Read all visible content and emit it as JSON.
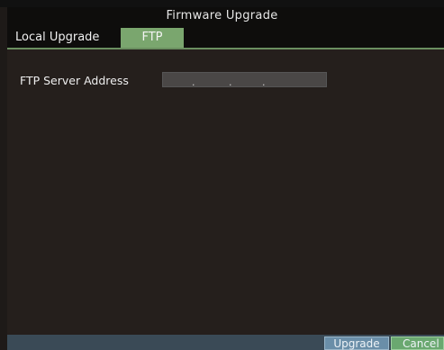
{
  "window": {
    "title": "Firmware Upgrade"
  },
  "tabs": [
    {
      "label": "Local Upgrade",
      "active": false
    },
    {
      "label": "FTP",
      "active": true
    }
  ],
  "ftp": {
    "server_address_label": "FTP Server Address",
    "server_address_value": ". . ."
  },
  "buttons": {
    "upgrade": "Upgrade",
    "cancel": "Cancel"
  },
  "colors": {
    "active_tab": "#7aa66e",
    "upgrade_button": "#6a8ea8",
    "cancel_button": "#6aa870",
    "background": "#251f1c"
  }
}
